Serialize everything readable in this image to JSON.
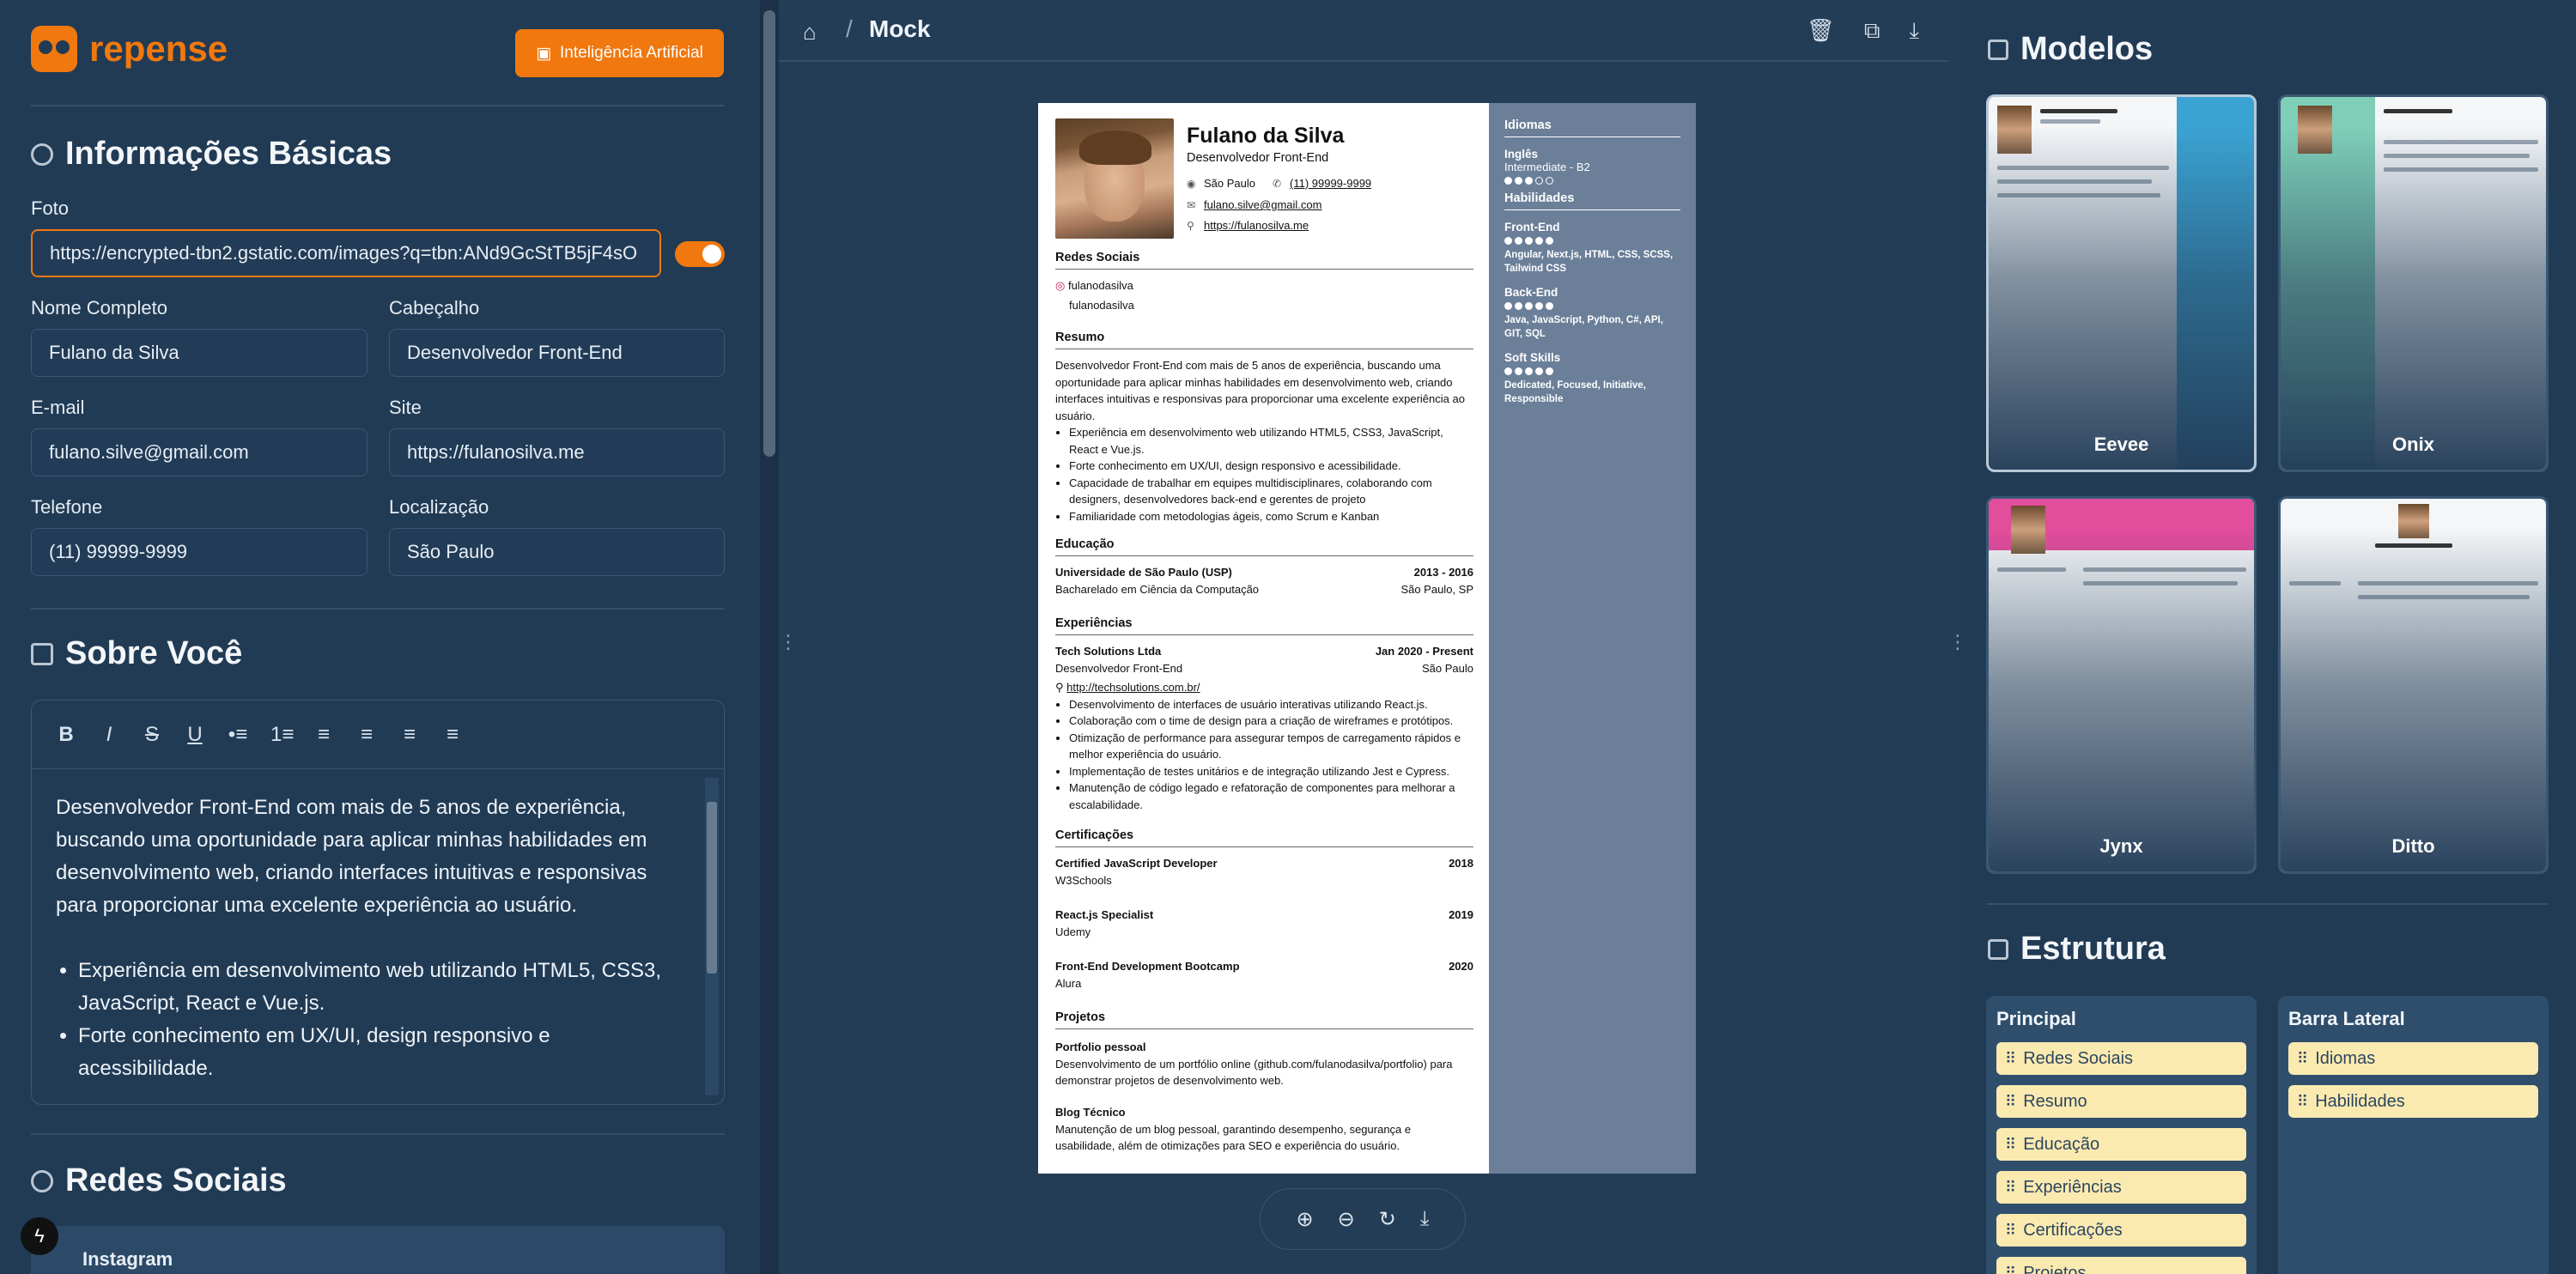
{
  "app": {
    "logo": "repense",
    "ai_button": "Inteligência Artificial"
  },
  "basic_info": {
    "title": "Informações Básicas",
    "photo_label": "Foto",
    "photo_value": "https://encrypted-tbn2.gstatic.com/images?q=tbn:ANd9GcStTB5jF4sO",
    "name_label": "Nome Completo",
    "name_value": "Fulano da Silva",
    "headline_label": "Cabeçalho",
    "headline_value": "Desenvolvedor Front-End",
    "email_label": "E-mail",
    "email_value": "fulano.silve@gmail.com",
    "site_label": "Site",
    "site_value": "https://fulanosilva.me",
    "phone_label": "Telefone",
    "phone_value": "(11) 99999-9999",
    "location_label": "Localização",
    "location_value": "São Paulo"
  },
  "about": {
    "title": "Sobre Você",
    "paragraph": "Desenvolvedor Front-End com mais de 5 anos de experiência, buscando uma oportunidade para aplicar minhas habilidades em desenvolvimento web, criando interfaces intuitivas e responsivas para proporcionar uma excelente experiência ao usuário.",
    "bullets": [
      "Experiência em desenvolvimento web utilizando HTML5, CSS3, JavaScript, React e Vue.js.",
      "Forte conhecimento em UX/UI, design responsivo e acessibilidade."
    ],
    "toolbar": [
      "B",
      "I",
      "S",
      "U",
      "•≡",
      "1≡",
      "≡",
      "≡",
      "≡",
      "≡"
    ]
  },
  "social": {
    "title": "Redes Sociais",
    "first_card": "Instagram"
  },
  "middle": {
    "breadcrumb": "Mock"
  },
  "resume": {
    "name": "Fulano da Silva",
    "headline": "Desenvolvedor Front-End",
    "location": "São Paulo",
    "phone": "(11) 99999-9999",
    "email": "fulano.silve@gmail.com",
    "site": "https://fulanosilva.me",
    "social_title": "Redes Sociais",
    "social": [
      "fulanodasilva",
      "fulanodasilva"
    ],
    "summary_title": "Resumo",
    "summary": "Desenvolvedor Front-End com mais de 5 anos de experiência, buscando uma oportunidade para aplicar minhas habilidades em desenvolvimento web, criando interfaces intuitivas e responsivas para proporcionar uma excelente experiência ao usuário.",
    "summary_bullets": [
      "Experiência em desenvolvimento web utilizando HTML5, CSS3, JavaScript, React e Vue.js.",
      "Forte conhecimento em UX/UI, design responsivo e acessibilidade.",
      "Capacidade de trabalhar em equipes multidisciplinares, colaborando com designers, desenvolvedores back-end e gerentes de projeto",
      "Familiaridade com metodologias ágeis, como Scrum e Kanban"
    ],
    "education_title": "Educação",
    "edu_school": "Universidade de São Paulo (USP)",
    "edu_dates": "2013 - 2016",
    "edu_degree": "Bacharelado em Ciência da Computação",
    "edu_place": "São Paulo, SP",
    "experience_title": "Experiências",
    "exp_company": "Tech Solutions Ltda",
    "exp_dates": "Jan 2020 - Present",
    "exp_role": "Desenvolvedor Front-End",
    "exp_place": "São Paulo",
    "exp_link": "http://techsolutions.com.br/",
    "exp_bullets": [
      "Desenvolvimento de interfaces de usuário interativas utilizando React.js.",
      "Colaboração com o time de design para a criação de wireframes e protótipos.",
      "Otimização de performance para assegurar tempos de carregamento rápidos e melhor experiência do usuário.",
      "Implementação de testes unitários e de integração utilizando Jest e Cypress.",
      "Manutenção de código legado e refatoração de componentes para melhorar a escalabilidade."
    ],
    "cert_title": "Certificações",
    "certs": [
      {
        "name": "Certified JavaScript Developer",
        "year": "2018",
        "org": "W3Schools"
      },
      {
        "name": "React.js Specialist",
        "year": "2019",
        "org": "Udemy"
      },
      {
        "name": "Front-End Development Bootcamp",
        "year": "2020",
        "org": "Alura"
      }
    ],
    "projects_title": "Projetos",
    "proj1_name": "Portfolio pessoal",
    "proj1_desc": "Desenvolvimento de um portfólio online (github.com/fulanodasilva/portfolio) para demonstrar projetos de desenvolvimento web.",
    "proj2_name": "Blog Técnico",
    "proj2_desc": "Manutenção de um blog pessoal, garantindo desempenho, segurança e usabilidade, além de otimizações para SEO e experiência do usuário.",
    "side_languages_title": "Idiomas",
    "lang_name": "Inglês",
    "lang_level": "Intermediate - B2",
    "lang_dots": 3,
    "side_skills_title": "Habilidades",
    "skills": [
      {
        "name": "Front-End",
        "dots": 5,
        "keywords": "Angular, Next.js, HTML, CSS, SCSS, Tailwind CSS"
      },
      {
        "name": "Back-End",
        "dots": 5,
        "keywords": "Java, JavaScript, Python, C#, API, GIT, SQL"
      },
      {
        "name": "Soft Skills",
        "dots": 5,
        "keywords": "Dedicated, Focused, Initiative, Responsible"
      }
    ]
  },
  "models": {
    "title": "Modelos",
    "items": [
      "Eevee",
      "Onix",
      "Jynx",
      "Ditto"
    ]
  },
  "structure": {
    "title": "Estrutura",
    "main_title": "Principal",
    "main_items": [
      "Redes Sociais",
      "Resumo",
      "Educação",
      "Experiências",
      "Certificações",
      "Projetos"
    ],
    "side_title": "Barra Lateral",
    "side_items": [
      "Idiomas",
      "Habilidades"
    ]
  },
  "colors": {
    "accent": "#f0780e",
    "panel": "#213b55",
    "sidebar": "#6b7f99",
    "pill": "#fbeab0"
  }
}
